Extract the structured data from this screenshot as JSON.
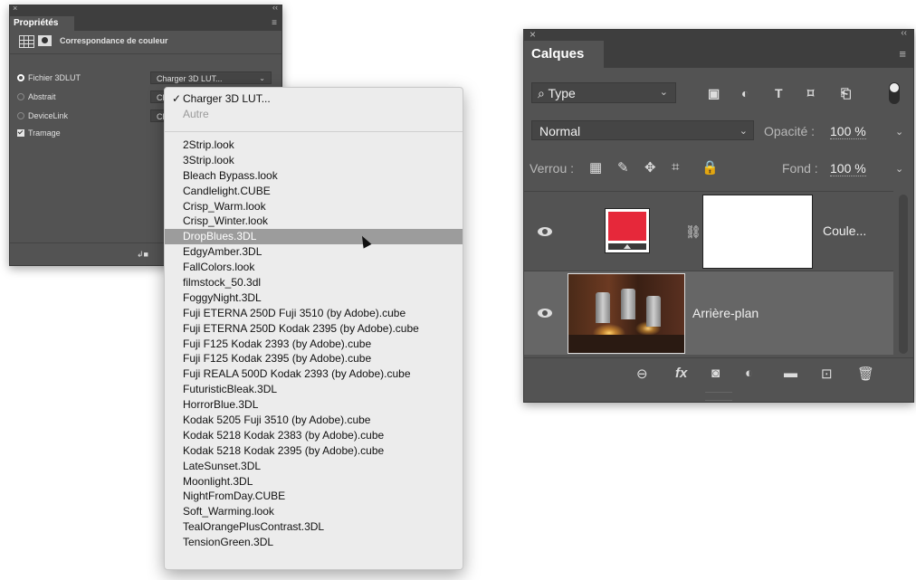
{
  "properties_panel": {
    "close": "×",
    "collapse": "‹‹",
    "tab_label": "Propriétés",
    "panel_menu": "≡",
    "header_title": "Correspondance de couleur",
    "options": [
      {
        "label": "Fichier 3DLUT",
        "selected": true,
        "combo_value": "Charger 3D LUT..."
      },
      {
        "label": "Abstrait",
        "selected": false,
        "combo_value": "Ch"
      },
      {
        "label": "DeviceLink",
        "selected": false,
        "combo_value": "Ch"
      }
    ],
    "dither_label": "Tramage",
    "dither_checked": true
  },
  "lut_menu": {
    "checked_item": "Charger 3D LUT...",
    "disabled_item": "Autre",
    "highlighted": "DropBlues.3DL",
    "items": [
      "2Strip.look",
      "3Strip.look",
      "Bleach Bypass.look",
      "Candlelight.CUBE",
      "Crisp_Warm.look",
      "Crisp_Winter.look",
      "DropBlues.3DL",
      "EdgyAmber.3DL",
      "FallColors.look",
      "filmstock_50.3dl",
      "FoggyNight.3DL",
      "Fuji ETERNA 250D Fuji 3510 (by Adobe).cube",
      "Fuji ETERNA 250D Kodak 2395 (by Adobe).cube",
      "Fuji F125 Kodak 2393 (by Adobe).cube",
      "Fuji F125 Kodak 2395 (by Adobe).cube",
      "Fuji REALA 500D Kodak 2393 (by Adobe).cube",
      "FuturisticBleak.3DL",
      "HorrorBlue.3DL",
      "Kodak 5205 Fuji 3510 (by Adobe).cube",
      "Kodak 5218 Kodak 2383 (by Adobe).cube",
      "Kodak 5218 Kodak 2395 (by Adobe).cube",
      "LateSunset.3DL",
      "Moonlight.3DL",
      "NightFromDay.CUBE",
      "Soft_Warming.look",
      "TealOrangePlusContrast.3DL",
      "TensionGreen.3DL"
    ]
  },
  "layers_panel": {
    "close": "×",
    "collapse": "‹‹",
    "tab_label": "Calques",
    "panel_menu": "≡",
    "filter_label": "Type",
    "blend_mode": "Normal",
    "opacity_label": "Opacité :",
    "opacity_value": "100 %",
    "lock_label": "Verrou :",
    "fill_label": "Fond :",
    "fill_value": "100 %",
    "layers": [
      {
        "name": "Coule...",
        "visible": true,
        "swatch_color": "#e6283a"
      },
      {
        "name": "Arrière-plan",
        "visible": true
      }
    ],
    "fx_label": "fx"
  }
}
